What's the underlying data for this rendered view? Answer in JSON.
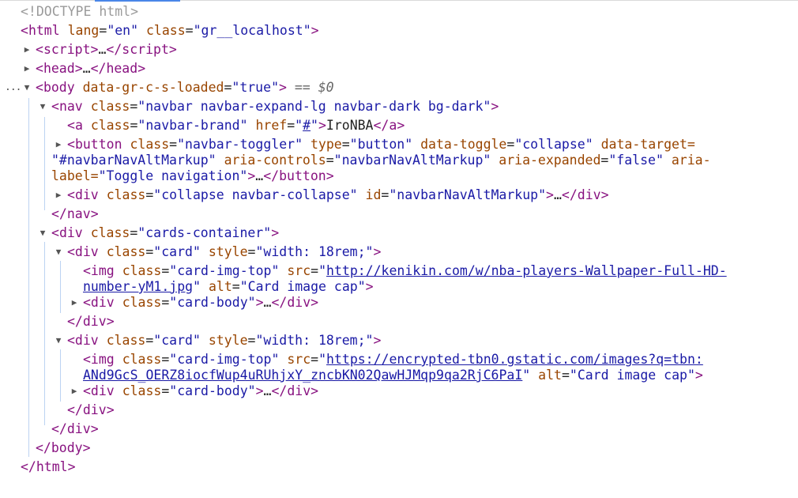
{
  "rows": {
    "doctype": "<!DOCTYPE html>",
    "html_open": {
      "tag": "html",
      "attrs": [
        {
          "n": "lang",
          "v": "en"
        },
        {
          "n": "class",
          "v": "gr__localhost"
        }
      ]
    },
    "script_collapsed": {
      "tag": "script",
      "ellipsis": "…"
    },
    "head_collapsed": {
      "tag": "head",
      "ellipsis": "…"
    },
    "body_open": {
      "tag": "body",
      "attrs": [
        {
          "n": "data-gr-c-s-loaded",
          "v": "true"
        }
      ],
      "eq": "==",
      "dollar": "$0"
    },
    "nav_open": {
      "tag": "nav",
      "attrs": [
        {
          "n": "class",
          "v": "navbar navbar-expand-lg navbar-dark bg-dark"
        }
      ]
    },
    "brand": {
      "tag": "a",
      "attrs": [
        {
          "n": "class",
          "v": "navbar-brand"
        },
        {
          "n": "href",
          "v": "#"
        }
      ],
      "text": "IroNBA"
    },
    "toggler": {
      "tag": "button",
      "line1": [
        {
          "n": "class",
          "v": "navbar-toggler"
        },
        {
          "n": "type",
          "v": "button"
        },
        {
          "n": "data-toggle",
          "v": "collapse"
        }
      ],
      "line1_tail": "data-target=",
      "line2_value": "\"#navbarNavAltMarkup\"",
      "line2_attrs": [
        {
          "n": "aria-controls",
          "v": "navbarNavAltMarkup"
        },
        {
          "n": "aria-expanded",
          "v": "false"
        }
      ],
      "line2_tail": "aria-",
      "line3_head": "label=",
      "line3_value": "\"Toggle navigation\"",
      "ellipsis": "…"
    },
    "collapse_div": {
      "tag": "div",
      "attrs": [
        {
          "n": "class",
          "v": "collapse navbar-collapse"
        },
        {
          "n": "id",
          "v": "navbarNavAltMarkup"
        }
      ],
      "ellipsis": "…"
    },
    "nav_close": "nav",
    "cards_container": {
      "tag": "div",
      "attrs": [
        {
          "n": "class",
          "v": "cards-container"
        }
      ]
    },
    "card1": {
      "attrs": [
        {
          "n": "class",
          "v": "card"
        },
        {
          "n": "style",
          "v": "width: 18rem;"
        }
      ],
      "img_attrs_head": [
        {
          "n": "class",
          "v": "card-img-top"
        }
      ],
      "src_line1": "http://kenikin.com/w/nba-players-Wallpaper-Full-HD-",
      "src_line2": "number-yM1.jpg",
      "alt": "Card image cap",
      "body_class": "card-body"
    },
    "card2": {
      "attrs": [
        {
          "n": "class",
          "v": "card"
        },
        {
          "n": "style",
          "v": "width: 18rem;"
        }
      ],
      "img_attrs_head": [
        {
          "n": "class",
          "v": "card-img-top"
        }
      ],
      "src_line1": "https://encrypted-tbn0.gstatic.com/images?q=tbn:",
      "src_line2": "ANd9GcS_OERZ8iocfWup4uRUhjxY_zncbKN02QawHJMqp9qa2RjC6PaI",
      "alt": "Card image cap",
      "body_class": "card-body"
    },
    "div_close": "div",
    "body_close": "body",
    "html_close": "html"
  }
}
